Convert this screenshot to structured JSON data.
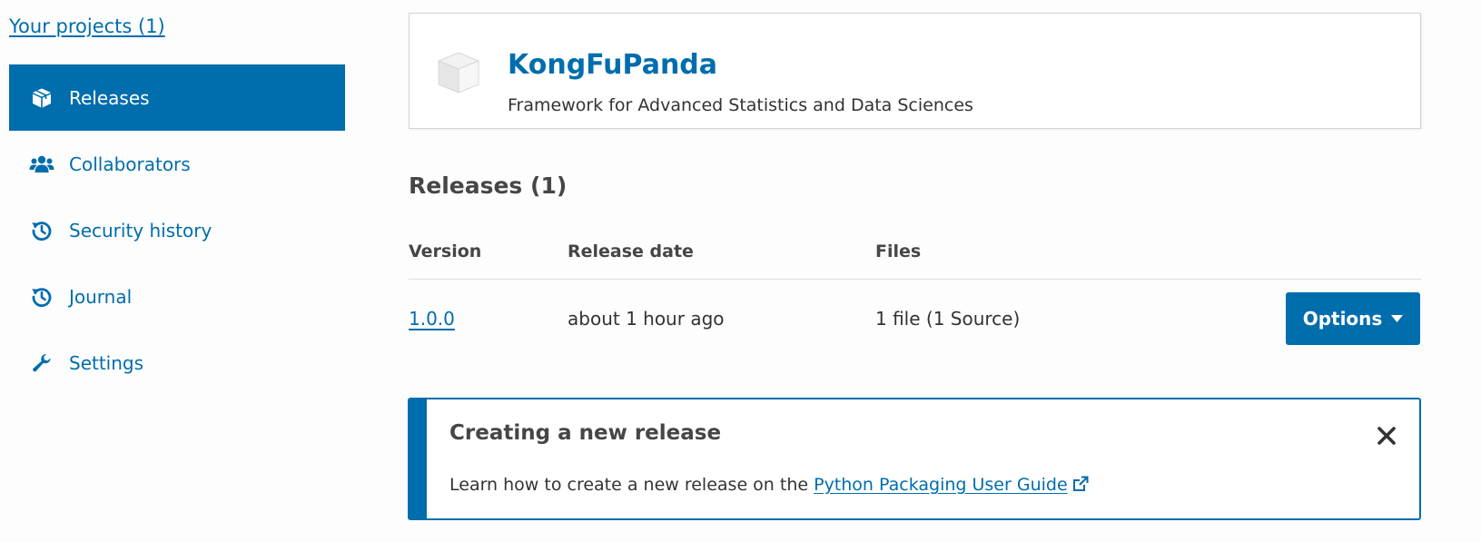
{
  "sidebar": {
    "your_projects": "Your projects (1)",
    "items": [
      {
        "label": "Releases",
        "icon": "box-icon",
        "active": true
      },
      {
        "label": "Collaborators",
        "icon": "users-icon",
        "active": false
      },
      {
        "label": "Security history",
        "icon": "history-icon",
        "active": false
      },
      {
        "label": "Journal",
        "icon": "history-icon",
        "active": false
      },
      {
        "label": "Settings",
        "icon": "wrench-icon",
        "active": false
      }
    ]
  },
  "project": {
    "icon": "package-icon",
    "name": "KongFuPanda",
    "description": "Framework for Advanced Statistics and Data Sciences"
  },
  "releases": {
    "title": "Releases (1)",
    "columns": [
      "Version",
      "Release date",
      "Files"
    ],
    "rows": [
      {
        "version": "1.0.0",
        "release_date": "about 1 hour ago",
        "files": "1 file (1 Source)"
      }
    ],
    "options_label": "Options"
  },
  "callout": {
    "title": "Creating a new release",
    "body_text": "Learn how to create a new release on the ",
    "link_text": "Python Packaging User Guide",
    "close_icon": "close-icon",
    "link_icon": "external-link-icon"
  },
  "colors": {
    "accent": "#006dad",
    "text": "#464646",
    "background": "#fdfdfd"
  }
}
